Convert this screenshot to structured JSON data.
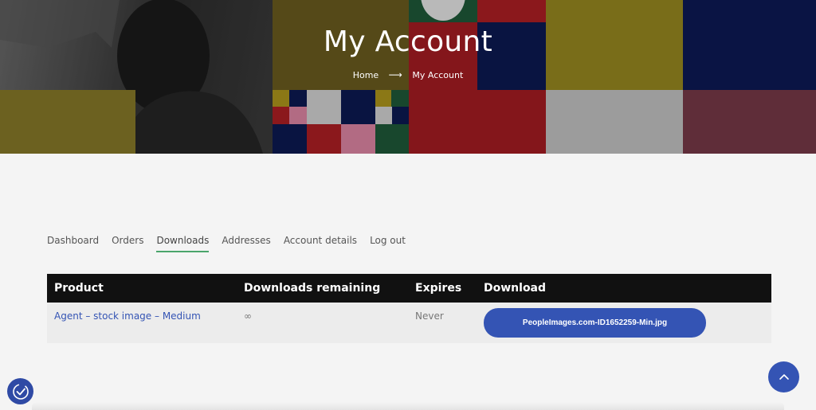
{
  "hero": {
    "title": "My Account",
    "breadcrumb": {
      "home": "Home",
      "separator": "⟶",
      "current": "My Account"
    }
  },
  "tabs": [
    {
      "label": "Dashboard",
      "active": false
    },
    {
      "label": "Orders",
      "active": false
    },
    {
      "label": "Downloads",
      "active": true
    },
    {
      "label": "Addresses",
      "active": false
    },
    {
      "label": "Account details",
      "active": false
    },
    {
      "label": "Log out",
      "active": false
    }
  ],
  "downloads_table": {
    "headers": [
      "Product",
      "Downloads remaining",
      "Expires",
      "Download"
    ],
    "rows": [
      {
        "product": "Agent – stock image – Medium",
        "remaining": "∞",
        "expires": "Never",
        "file": "PeopleImages.com-ID1652259-Min.jpg"
      }
    ]
  },
  "colors": {
    "accent": "#3454b4",
    "tab_underline": "#4aa56b",
    "header_bg": "#111111"
  },
  "icons": {
    "scroll_top": "chevron-up-icon",
    "accessibility": "accessibility-icon"
  }
}
